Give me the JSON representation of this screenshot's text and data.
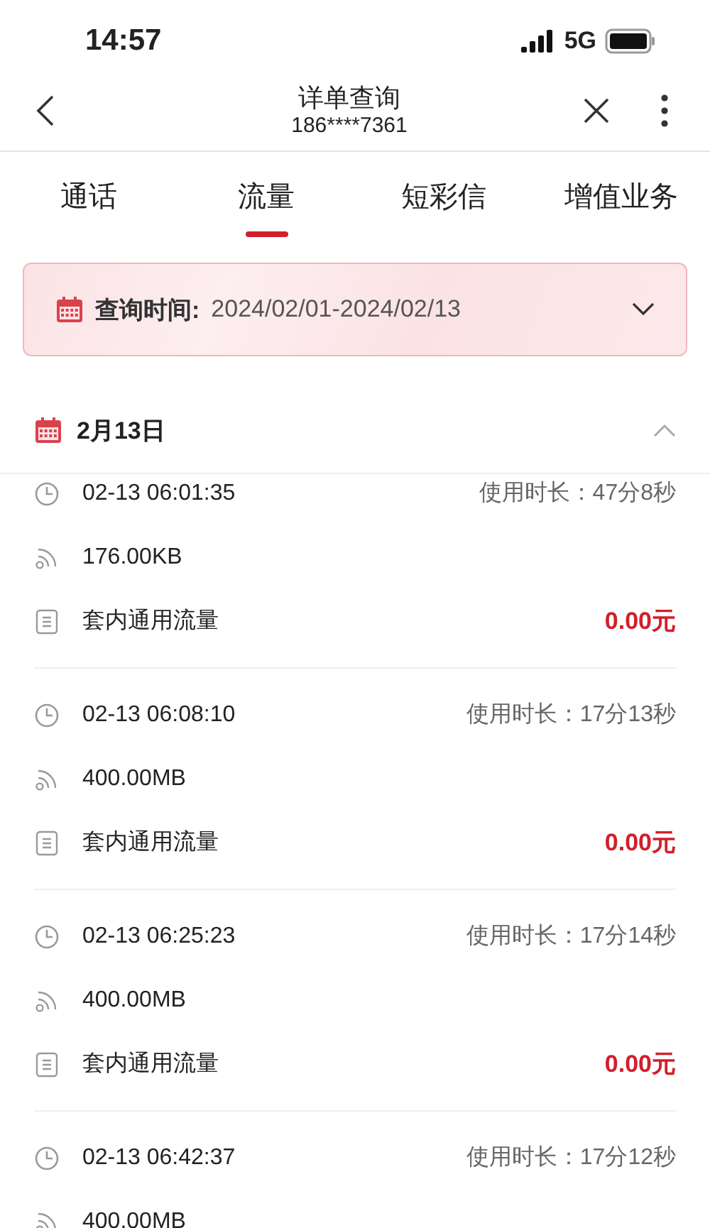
{
  "status_bar": {
    "time": "14:57",
    "network": "5G"
  },
  "nav": {
    "title": "详单查询",
    "subtitle": "186****7361"
  },
  "tabs": [
    {
      "label": "通话",
      "selected": false
    },
    {
      "label": "流量",
      "selected": true
    },
    {
      "label": "短彩信",
      "selected": false
    },
    {
      "label": "增值业务",
      "selected": false
    }
  ],
  "filter": {
    "label": "查询时间:",
    "value": "2024/02/01-2024/02/13"
  },
  "day": {
    "label": "2月13日",
    "expanded": true
  },
  "records": [
    {
      "time": "02-13 06:01:35",
      "duration": "使用时长：47分8秒",
      "data": "176.00KB",
      "plan": "套内通用流量",
      "fee": "0.00元"
    },
    {
      "time": "02-13 06:08:10",
      "duration": "使用时长：17分13秒",
      "data": "400.00MB",
      "plan": "套内通用流量",
      "fee": "0.00元"
    },
    {
      "time": "02-13 06:25:23",
      "duration": "使用时长：17分14秒",
      "data": "400.00MB",
      "plan": "套内通用流量",
      "fee": "0.00元"
    },
    {
      "time": "02-13 06:42:37",
      "duration": "使用时长：17分12秒",
      "data": "400.00MB"
    }
  ]
}
